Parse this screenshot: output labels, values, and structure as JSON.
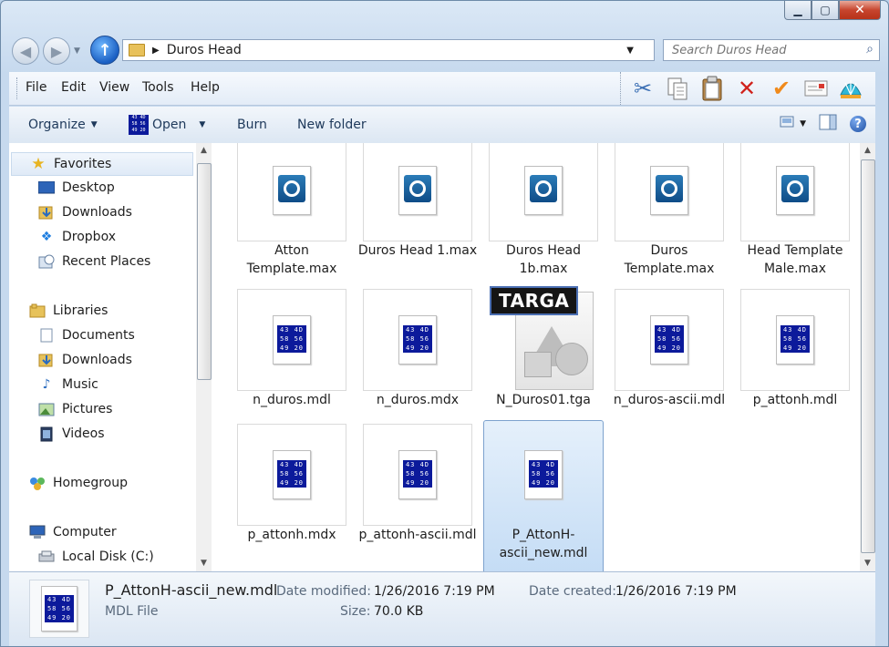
{
  "window": {
    "caption_minimize": "▁",
    "caption_maximize": "▢",
    "caption_close": "✕"
  },
  "address": {
    "breadcrumb": "Duros Head"
  },
  "search": {
    "placeholder": "Search Duros Head"
  },
  "menu": [
    "File",
    "Edit",
    "View",
    "Tools",
    "Help"
  ],
  "commands": {
    "organize": "Organize",
    "open": "Open",
    "burn": "Burn",
    "new_folder": "New folder"
  },
  "mdl_icon_text": [
    "43 4D",
    "58 56",
    "49 20"
  ],
  "navigation": {
    "favorites": {
      "label": "Favorites",
      "items": [
        "Desktop",
        "Downloads",
        "Dropbox",
        "Recent Places"
      ]
    },
    "libraries": {
      "label": "Libraries",
      "items": [
        "Documents",
        "Downloads",
        "Music",
        "Pictures",
        "Videos"
      ]
    },
    "homegroup": "Homegroup",
    "computer": {
      "label": "Computer",
      "items": [
        "Local Disk (C:)"
      ]
    }
  },
  "files": [
    {
      "name": "Atton Template.max",
      "type": "max"
    },
    {
      "name": "Duros Head 1.max",
      "type": "max"
    },
    {
      "name": "Duros Head 1b.max",
      "type": "max"
    },
    {
      "name": "Duros Template.max",
      "type": "max"
    },
    {
      "name": "Head Template Male.max",
      "type": "max"
    },
    {
      "name": "n_duros.mdl",
      "type": "mdl"
    },
    {
      "name": "n_duros.mdx",
      "type": "mdl"
    },
    {
      "name": "N_Duros01.tga",
      "type": "tga",
      "badge": "TARGA"
    },
    {
      "name": "n_duros-ascii.mdl",
      "type": "mdl"
    },
    {
      "name": "p_attonh.mdl",
      "type": "mdl"
    },
    {
      "name": "p_attonh.mdx",
      "type": "mdl"
    },
    {
      "name": "p_attonh-ascii.mdl",
      "type": "mdl"
    },
    {
      "name": "P_AttonH-ascii_new.mdl",
      "type": "mdl",
      "selected": true
    }
  ],
  "details": {
    "filename": "P_AttonH-ascii_new.mdl",
    "filetype": "MDL File",
    "modified_label": "Date modified:",
    "modified_value": "1/26/2016 7:19 PM",
    "created_label": "Date created:",
    "created_value": "1/26/2016 7:19 PM",
    "size_label": "Size:",
    "size_value": "70.0 KB"
  }
}
